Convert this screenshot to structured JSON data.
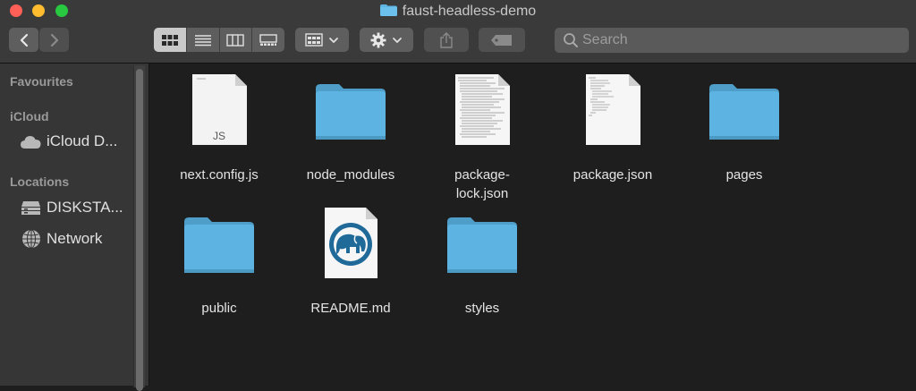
{
  "window": {
    "title": "faust-headless-demo",
    "accent_folder_color": "#5eb4e3"
  },
  "toolbar": {
    "back_icon": "chevron-left-icon",
    "forward_icon": "chevron-right-icon",
    "view_modes": [
      "icon-view",
      "list-view",
      "column-view",
      "gallery-view"
    ],
    "active_view": "icon-view",
    "group_icon": "group-by-icon",
    "action_icon": "gear-icon",
    "share_icon": "share-icon",
    "tag_icon": "tag-icon"
  },
  "search": {
    "placeholder": "Search"
  },
  "sidebar": {
    "sections": [
      {
        "header": "Favourites",
        "items": []
      },
      {
        "header": "iCloud",
        "items": [
          {
            "label": "iCloud D...",
            "icon": "cloud-icon"
          }
        ]
      },
      {
        "header": "Locations",
        "items": [
          {
            "label": "DISKSTA...",
            "icon": "disk-icon"
          },
          {
            "label": "Network",
            "icon": "globe-icon"
          }
        ]
      }
    ]
  },
  "files": [
    {
      "name": "next.config.js",
      "kind": "js-file",
      "badge": "JS"
    },
    {
      "name": "node_modules",
      "kind": "folder"
    },
    {
      "name": "package-\nlock.json",
      "kind": "text-file"
    },
    {
      "name": "package.json",
      "kind": "text-file"
    },
    {
      "name": "pages",
      "kind": "folder"
    },
    {
      "name": "public",
      "kind": "folder"
    },
    {
      "name": "README.md",
      "kind": "markdown-file"
    },
    {
      "name": "styles",
      "kind": "folder"
    }
  ]
}
